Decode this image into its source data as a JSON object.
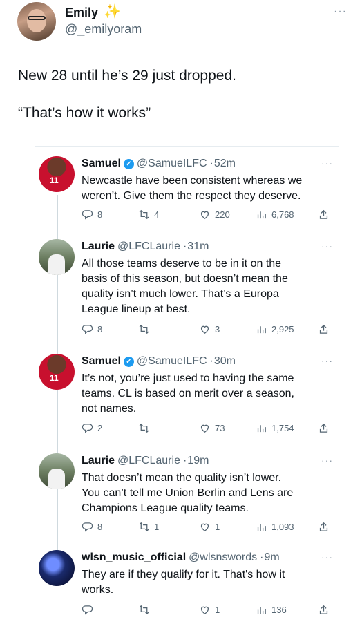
{
  "author": {
    "name": "Emily",
    "handle": "@_emilyoram",
    "sparkle": "✨",
    "more": "···"
  },
  "tweet": {
    "text": "New 28 until he’s 29 just dropped.\n\n“That’s how it works”"
  },
  "replies": [
    {
      "name": "Samuel",
      "verified": true,
      "handle": "@SamueILFC",
      "time": "52m",
      "text": "Newcastle have been consistent whereas we\nweren’t. Give them the respect they deserve.",
      "replies": "8",
      "retweets": "4",
      "likes": "220",
      "views": "6,768",
      "avatar": "salah-shirt"
    },
    {
      "name": "Laurie",
      "verified": false,
      "handle": "@LFCLaurie",
      "time": "31m",
      "text": "All those teams deserve to be in it on the\nbasis of this season, but doesn’t mean the\nquality isn’t much lower. That’s a Europa\nLeague lineup at best.",
      "replies": "8",
      "retweets": "",
      "likes": "3",
      "views": "2,925",
      "avatar": "person-outdoor"
    },
    {
      "name": "Samuel",
      "verified": true,
      "handle": "@SamueILFC",
      "time": "30m",
      "text": "It’s not, you’re just used to having the same\nteams. CL is based on merit over a season,\nnot names.",
      "replies": "2",
      "retweets": "",
      "likes": "73",
      "views": "1,754",
      "avatar": "salah-shirt"
    },
    {
      "name": "Laurie",
      "verified": false,
      "handle": "@LFCLaurie",
      "time": "19m",
      "text": "That doesn’t mean the quality isn’t lower.\nYou can’t tell me Union Berlin and Lens are\nChampions League quality teams.",
      "replies": "8",
      "retweets": "1",
      "likes": "1",
      "views": "1,093",
      "avatar": "person-outdoor"
    },
    {
      "name": "wlsn_music_official",
      "verified": false,
      "handle": "@wlsnswords",
      "time": "9m",
      "text": "They are if they qualify for it. That's how it\nworks.",
      "replies": "",
      "retweets": "",
      "likes": "1",
      "views": "136",
      "avatar": "blue-lights"
    }
  ],
  "colors": {
    "text": "#0f1419",
    "secondary": "#536471",
    "verified": "#1d9bf0",
    "divider": "#cfd9de"
  },
  "avatar_jersey_number": "11"
}
